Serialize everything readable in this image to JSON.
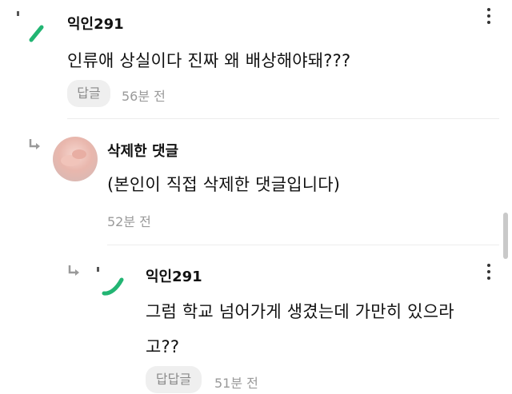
{
  "comments": [
    {
      "username": "익인291",
      "text": "인류애 상실이다 진짜 왜 배상해야돼???",
      "reply_label": "답글",
      "time": "56분 전"
    },
    {
      "username": "삭제한 댓글",
      "text": "(본인이 직접 삭제한 댓글입니다)",
      "time": "52분 전"
    },
    {
      "username": "익인291",
      "text_line1": "그럼 학교 넘어가게 생겼는데 가만히 있으라",
      "text_line2": "고??",
      "reply_label": "답답글",
      "time": "51분 전"
    }
  ],
  "icons": {
    "reply_arrow": "reply-arrow-icon",
    "more": "more-vertical-icon",
    "avatar_mark": "green-slash-icon"
  },
  "colors": {
    "accent_green": "#22b573",
    "reply_arrow": "#9a9a9a"
  }
}
